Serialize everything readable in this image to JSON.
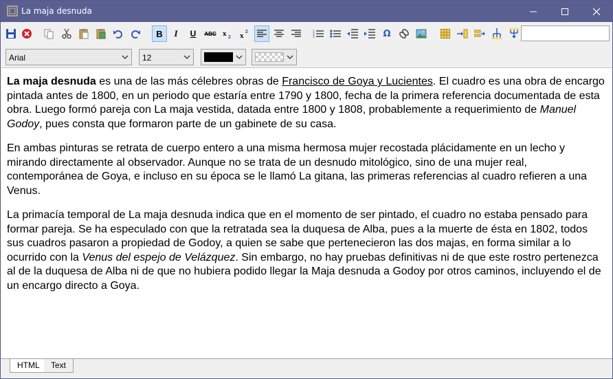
{
  "window": {
    "title": "La maja desnuda",
    "accent": "#5a5f92"
  },
  "toolbar": {
    "buttons": [
      {
        "name": "save-icon"
      },
      {
        "name": "close-document-icon"
      },
      {
        "name": "copy-icon"
      },
      {
        "name": "cut-icon"
      },
      {
        "name": "paste-icon"
      },
      {
        "name": "paste-special-icon"
      },
      {
        "name": "undo-icon"
      },
      {
        "name": "redo-icon"
      },
      {
        "name": "bold-icon",
        "pressed": true
      },
      {
        "name": "italic-icon"
      },
      {
        "name": "underline-icon"
      },
      {
        "name": "strikethrough-icon"
      },
      {
        "name": "subscript-icon"
      },
      {
        "name": "superscript-icon"
      },
      {
        "name": "align-left-icon",
        "pressed": true
      },
      {
        "name": "align-center-icon"
      },
      {
        "name": "align-right-icon"
      },
      {
        "name": "numbered-list-icon"
      },
      {
        "name": "bullet-list-icon"
      },
      {
        "name": "outdent-icon"
      },
      {
        "name": "indent-icon"
      },
      {
        "name": "special-character-icon"
      },
      {
        "name": "link-icon"
      },
      {
        "name": "image-icon"
      },
      {
        "name": "table-icon"
      },
      {
        "name": "insert-column-icon"
      },
      {
        "name": "insert-row-icon"
      },
      {
        "name": "split-icon"
      },
      {
        "name": "merge-icon"
      }
    ],
    "bold_label": "B",
    "italic_label": "I",
    "underline_label": "U",
    "strike_label": "ABC",
    "omega_label": "Ω",
    "search_value": ""
  },
  "format": {
    "font_family": "Arial",
    "font_size": "12",
    "text_color": "#000000",
    "background_color": "transparent"
  },
  "document": {
    "p1": {
      "bold": "La maja desnuda",
      "t1": " es una de las más célebres obras de ",
      "link": "Francisco de Goya y Lucientes",
      "t2": ". El cuadro es una obra de encargo pintada antes de 1800, en un periodo que estaría entre 1790 y 1800, fecha de la primera referencia documentada de esta obra. Luego formó pareja con La maja vestida, datada entre 1800 y 1808, probablemente a requerimiento de ",
      "italic": "Manuel Godoy",
      "t3": ", pues consta que formaron parte de un gabinete de su casa."
    },
    "p2": "En ambas pinturas se retrata de cuerpo entero a una misma hermosa mujer recostada plácidamente en un lecho y mirando directamente al observador. Aunque no se trata de un desnudo mitológico, sino de una mujer real, contemporánea de Goya, e incluso en su época se le llamó La gitana, las primeras referencias al cuadro refieren a una Venus.",
    "p3": {
      "t1": "La primacía temporal de La maja desnuda indica que en el momento de ser pintado, el cuadro no estaba pensado para formar pareja. Se ha especulado con que la retratada sea la duquesa de Alba, pues a la muerte de ésta en 1802, todos sus cuadros pasaron a propiedad de Godoy, a quien se sabe que pertenecieron las dos majas, en forma similar a lo ocurrido con la ",
      "italic": "Venus del espejo de Velázquez",
      "t2": ". Sin embargo, no hay pruebas definitivas ni de que este rostro pertenezca al de la duquesa de Alba ni de que no hubiera podido llegar la Maja desnuda a Godoy por otros caminos, incluyendo el de un encargo directo a Goya."
    }
  },
  "tabs": [
    {
      "label": "HTML",
      "active": true
    },
    {
      "label": "Text",
      "active": false
    }
  ]
}
